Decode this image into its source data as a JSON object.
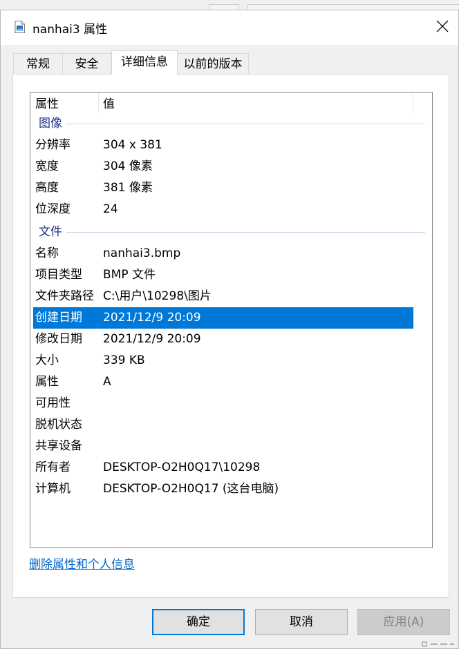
{
  "window": {
    "title": "nanhai3 属性"
  },
  "tabs": [
    {
      "label": "常规"
    },
    {
      "label": "安全"
    },
    {
      "label": "详细信息"
    },
    {
      "label": "以前的版本"
    }
  ],
  "details": {
    "columns": {
      "name": "属性",
      "value": "值"
    },
    "groups": {
      "image": "图像",
      "file": "文件"
    },
    "image_rows": [
      {
        "name": "分辨率",
        "value": "304 x 381"
      },
      {
        "name": "宽度",
        "value": "304 像素"
      },
      {
        "name": "高度",
        "value": "381 像素"
      },
      {
        "name": "位深度",
        "value": "24"
      }
    ],
    "file_rows": [
      {
        "name": "名称",
        "value": "nanhai3.bmp"
      },
      {
        "name": "项目类型",
        "value": "BMP 文件"
      },
      {
        "name": "文件夹路径",
        "value": "C:\\用户\\10298\\图片"
      },
      {
        "name": "创建日期",
        "value": "2021/12/9 20:09",
        "selected": true
      },
      {
        "name": "修改日期",
        "value": "2021/12/9 20:09"
      },
      {
        "name": "大小",
        "value": "339 KB"
      },
      {
        "name": "属性",
        "value": "A"
      },
      {
        "name": "可用性",
        "value": ""
      },
      {
        "name": "脱机状态",
        "value": ""
      },
      {
        "name": "共享设备",
        "value": ""
      },
      {
        "name": "所有者",
        "value": "DESKTOP-O2H0Q17\\10298"
      },
      {
        "name": "计算机",
        "value": "DESKTOP-O2H0Q17 (这台电脑)"
      }
    ]
  },
  "link": {
    "label": "删除属性和个人信息"
  },
  "buttons": {
    "ok": "确定",
    "cancel": "取消",
    "apply": "应用(A)"
  },
  "colors": {
    "selection": "#0078d7",
    "group_header": "#1e3287",
    "link": "#0066cc"
  }
}
